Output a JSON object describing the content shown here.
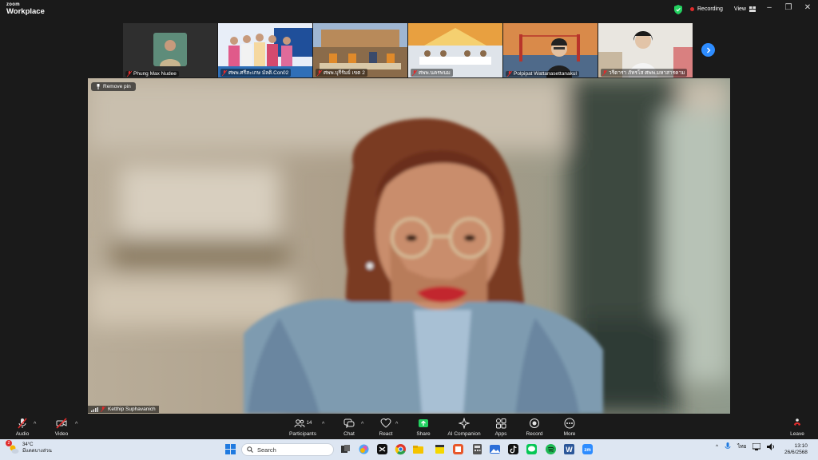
{
  "app": {
    "brand_top": "zoom",
    "brand_main": "Workplace"
  },
  "titlebar": {
    "recording_label": "Recording",
    "view_label": "View",
    "minimize": "–",
    "restore": "❐",
    "close": "✕",
    "accent": "#2d8cff",
    "recording_color": "#e02b2b"
  },
  "thumbnails": [
    {
      "name": "Phung Max Nudee",
      "bg": "#2f2f2f"
    },
    {
      "name": "ศพพ.ศรีสะเกษ มัลติ.Con02",
      "bg": "#2f6fb8"
    },
    {
      "name": "ศพพ.บุรีรัมย์ เขต 2",
      "bg": "#7c8fa6"
    },
    {
      "name": "ศพพ.นครพนม",
      "bg": "#c87a3a"
    },
    {
      "name": "Polpipat Wattanasettanakul",
      "bg": "#a8713e"
    },
    {
      "name": "วรีดารา ภัทรโส ศพพ.มหาสารคาม",
      "bg": "#d9d4cc"
    }
  ],
  "stage": {
    "remove_pin_label": "Remove pin",
    "speaker_name": "Ketthip Suphavanich"
  },
  "toolbar": {
    "audio": "Audio",
    "video": "Video",
    "participants": "Participants",
    "participants_count": "14",
    "chat": "Chat",
    "react": "React",
    "share": "Share",
    "ai_companion": "AI Companion",
    "apps": "Apps",
    "record": "Record",
    "more": "More",
    "leave": "Leave",
    "share_color": "#23d160",
    "mute_color": "#e02b2b"
  },
  "taskbar": {
    "weather_temp": "34°C",
    "weather_desc": "มีแดดบางส่วน",
    "weather_badge": "2",
    "search_placeholder": "Search",
    "language": "ไทย",
    "time": "13:10",
    "date": "26/6/2568"
  }
}
